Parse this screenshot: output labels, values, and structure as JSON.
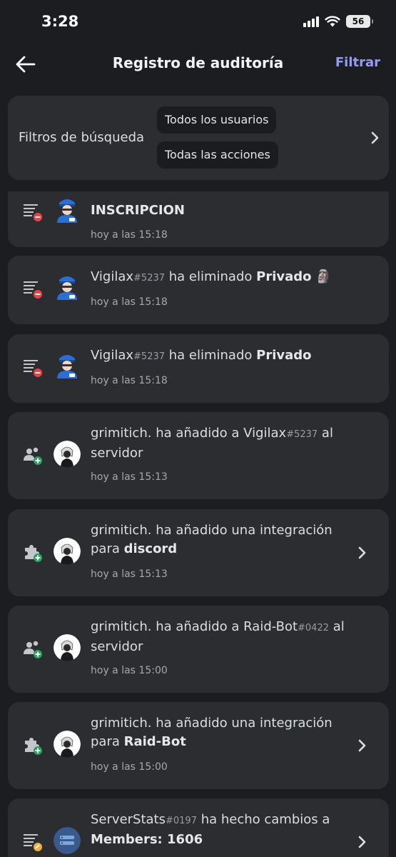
{
  "status_bar": {
    "time": "3:28",
    "battery": "56"
  },
  "header": {
    "title": "Registro de auditoría",
    "filter_label": "Filtrar"
  },
  "filters": {
    "label": "Filtros de búsqueda",
    "users_chip": "Todos los usuarios",
    "actions_chip": "Todas las acciones"
  },
  "entries": [
    {
      "title": "INSCRIPCION",
      "time": "hoy a las 15:18",
      "icon": "channel-delete-icon",
      "avatar": "bot-avatar"
    },
    {
      "actor": "Vigilax",
      "actor_tag": "#5237",
      "action": "ha eliminado",
      "target": "Privado",
      "target_emoji": "🗿",
      "time": "hoy a las 15:18",
      "icon": "channel-delete-icon",
      "avatar": "bot-avatar"
    },
    {
      "actor": "Vigilax",
      "actor_tag": "#5237",
      "action": "ha eliminado",
      "target": "Privado",
      "time": "hoy a las 15:18",
      "icon": "channel-delete-icon",
      "avatar": "bot-avatar"
    },
    {
      "actor": "grimitich.",
      "action": "ha añadido a",
      "target": "Vigilax",
      "target_tag": "#5237",
      "suffix": "al servidor",
      "time": "hoy a las 15:13",
      "icon": "member-add-icon",
      "avatar": "user-avatar"
    },
    {
      "actor": "grimitich.",
      "action": "ha añadido una integración para",
      "target": "discord",
      "time": "hoy a las 15:13",
      "icon": "integration-add-icon",
      "avatar": "user-avatar"
    },
    {
      "actor": "grimitich.",
      "action": "ha añadido a",
      "target": "Raid-Bot",
      "target_tag": "#0422",
      "suffix": "al servidor",
      "time": "hoy a las 15:00",
      "icon": "member-add-icon",
      "avatar": "user-avatar"
    },
    {
      "actor": "grimitich.",
      "action": "ha añadido una integración para",
      "target": "Raid-Bot",
      "time": "hoy a las 15:00",
      "icon": "integration-add-icon",
      "avatar": "user-avatar"
    },
    {
      "actor": "ServerStats",
      "actor_tag": "#0197",
      "action": "ha hecho cambios a",
      "target": "Members: 1606",
      "icon": "channel-update-icon",
      "avatar": "serverstats-avatar"
    }
  ],
  "colors": {
    "background": "#1c1d21",
    "card": "#2b2d31",
    "accent": "#949cf7",
    "delete_badge": "#ed4245",
    "add_badge": "#23a55a"
  }
}
